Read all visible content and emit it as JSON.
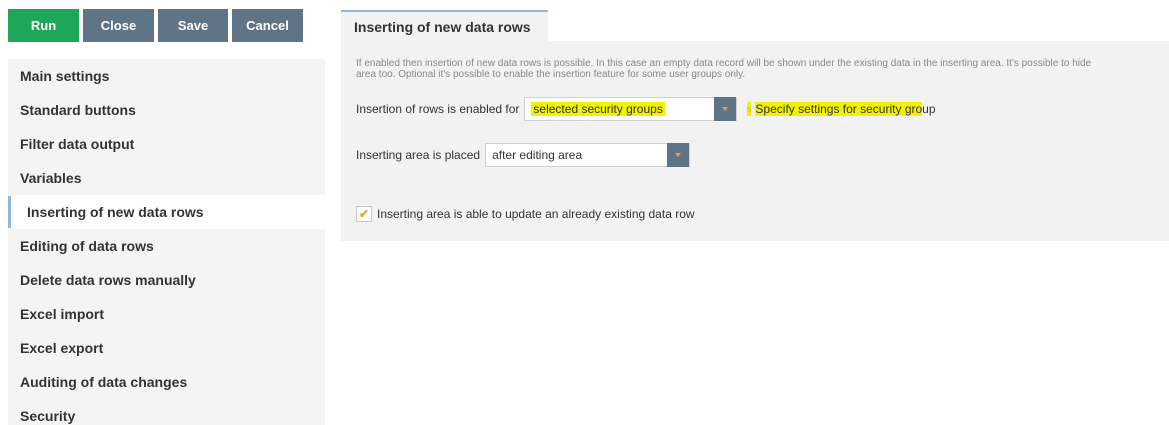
{
  "toolbar": {
    "run_label": "Run",
    "close_label": "Close",
    "save_label": "Save",
    "cancel_label": "Cancel"
  },
  "sidebar": {
    "items": [
      {
        "label": "Main settings"
      },
      {
        "label": "Standard buttons"
      },
      {
        "label": "Filter data output"
      },
      {
        "label": "Variables"
      },
      {
        "label": "Inserting of new data rows",
        "active": true
      },
      {
        "label": "Editing of data rows"
      },
      {
        "label": "Delete data rows manually"
      },
      {
        "label": "Excel import"
      },
      {
        "label": "Excel export"
      },
      {
        "label": "Auditing of data changes"
      },
      {
        "label": "Security"
      }
    ]
  },
  "tab": {
    "title": "Inserting of new data rows"
  },
  "panel": {
    "description_line1": "If enabled then insertion of new data rows is possible. In this case an empty data record will be shown under the existing data in the inserting area. It's possible to hide",
    "description_line2": "area too. Optional it's possible to enable the insertion feature for some user groups only.",
    "insertion_label": "Insertion of rows is enabled for",
    "insertion_value": "selected security groups",
    "specify_link": "Specify settings for security gro",
    "specify_link_tail": "up",
    "area_label": "Inserting area is placed",
    "area_value": "after editing area",
    "update_checkbox_label": "Inserting area is able to update an already existing data row",
    "update_checked": true
  },
  "colors": {
    "run": "#1ea65a",
    "toolbar_button": "#5f7486",
    "highlight": "#f2f200",
    "accent": "#e8a13a",
    "active_indicator": "#8db7dd"
  }
}
